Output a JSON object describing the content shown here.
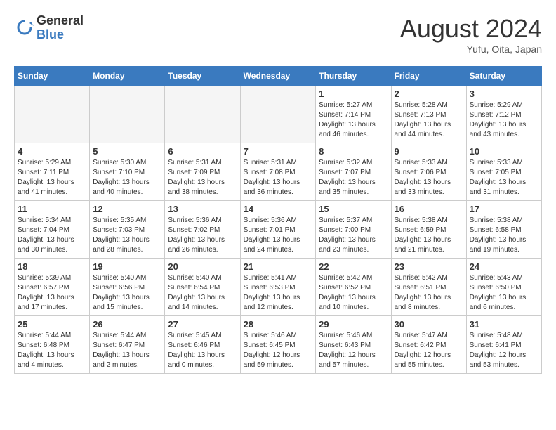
{
  "logo": {
    "general": "General",
    "blue": "Blue"
  },
  "header": {
    "month_year": "August 2024",
    "location": "Yufu, Oita, Japan"
  },
  "weekdays": [
    "Sunday",
    "Monday",
    "Tuesday",
    "Wednesday",
    "Thursday",
    "Friday",
    "Saturday"
  ],
  "weeks": [
    [
      {
        "day": "",
        "info": ""
      },
      {
        "day": "",
        "info": ""
      },
      {
        "day": "",
        "info": ""
      },
      {
        "day": "",
        "info": ""
      },
      {
        "day": "1",
        "info": "Sunrise: 5:27 AM\nSunset: 7:14 PM\nDaylight: 13 hours\nand 46 minutes."
      },
      {
        "day": "2",
        "info": "Sunrise: 5:28 AM\nSunset: 7:13 PM\nDaylight: 13 hours\nand 44 minutes."
      },
      {
        "day": "3",
        "info": "Sunrise: 5:29 AM\nSunset: 7:12 PM\nDaylight: 13 hours\nand 43 minutes."
      }
    ],
    [
      {
        "day": "4",
        "info": "Sunrise: 5:29 AM\nSunset: 7:11 PM\nDaylight: 13 hours\nand 41 minutes."
      },
      {
        "day": "5",
        "info": "Sunrise: 5:30 AM\nSunset: 7:10 PM\nDaylight: 13 hours\nand 40 minutes."
      },
      {
        "day": "6",
        "info": "Sunrise: 5:31 AM\nSunset: 7:09 PM\nDaylight: 13 hours\nand 38 minutes."
      },
      {
        "day": "7",
        "info": "Sunrise: 5:31 AM\nSunset: 7:08 PM\nDaylight: 13 hours\nand 36 minutes."
      },
      {
        "day": "8",
        "info": "Sunrise: 5:32 AM\nSunset: 7:07 PM\nDaylight: 13 hours\nand 35 minutes."
      },
      {
        "day": "9",
        "info": "Sunrise: 5:33 AM\nSunset: 7:06 PM\nDaylight: 13 hours\nand 33 minutes."
      },
      {
        "day": "10",
        "info": "Sunrise: 5:33 AM\nSunset: 7:05 PM\nDaylight: 13 hours\nand 31 minutes."
      }
    ],
    [
      {
        "day": "11",
        "info": "Sunrise: 5:34 AM\nSunset: 7:04 PM\nDaylight: 13 hours\nand 30 minutes."
      },
      {
        "day": "12",
        "info": "Sunrise: 5:35 AM\nSunset: 7:03 PM\nDaylight: 13 hours\nand 28 minutes."
      },
      {
        "day": "13",
        "info": "Sunrise: 5:36 AM\nSunset: 7:02 PM\nDaylight: 13 hours\nand 26 minutes."
      },
      {
        "day": "14",
        "info": "Sunrise: 5:36 AM\nSunset: 7:01 PM\nDaylight: 13 hours\nand 24 minutes."
      },
      {
        "day": "15",
        "info": "Sunrise: 5:37 AM\nSunset: 7:00 PM\nDaylight: 13 hours\nand 23 minutes."
      },
      {
        "day": "16",
        "info": "Sunrise: 5:38 AM\nSunset: 6:59 PM\nDaylight: 13 hours\nand 21 minutes."
      },
      {
        "day": "17",
        "info": "Sunrise: 5:38 AM\nSunset: 6:58 PM\nDaylight: 13 hours\nand 19 minutes."
      }
    ],
    [
      {
        "day": "18",
        "info": "Sunrise: 5:39 AM\nSunset: 6:57 PM\nDaylight: 13 hours\nand 17 minutes."
      },
      {
        "day": "19",
        "info": "Sunrise: 5:40 AM\nSunset: 6:56 PM\nDaylight: 13 hours\nand 15 minutes."
      },
      {
        "day": "20",
        "info": "Sunrise: 5:40 AM\nSunset: 6:54 PM\nDaylight: 13 hours\nand 14 minutes."
      },
      {
        "day": "21",
        "info": "Sunrise: 5:41 AM\nSunset: 6:53 PM\nDaylight: 13 hours\nand 12 minutes."
      },
      {
        "day": "22",
        "info": "Sunrise: 5:42 AM\nSunset: 6:52 PM\nDaylight: 13 hours\nand 10 minutes."
      },
      {
        "day": "23",
        "info": "Sunrise: 5:42 AM\nSunset: 6:51 PM\nDaylight: 13 hours\nand 8 minutes."
      },
      {
        "day": "24",
        "info": "Sunrise: 5:43 AM\nSunset: 6:50 PM\nDaylight: 13 hours\nand 6 minutes."
      }
    ],
    [
      {
        "day": "25",
        "info": "Sunrise: 5:44 AM\nSunset: 6:48 PM\nDaylight: 13 hours\nand 4 minutes."
      },
      {
        "day": "26",
        "info": "Sunrise: 5:44 AM\nSunset: 6:47 PM\nDaylight: 13 hours\nand 2 minutes."
      },
      {
        "day": "27",
        "info": "Sunrise: 5:45 AM\nSunset: 6:46 PM\nDaylight: 13 hours\nand 0 minutes."
      },
      {
        "day": "28",
        "info": "Sunrise: 5:46 AM\nSunset: 6:45 PM\nDaylight: 12 hours\nand 59 minutes."
      },
      {
        "day": "29",
        "info": "Sunrise: 5:46 AM\nSunset: 6:43 PM\nDaylight: 12 hours\nand 57 minutes."
      },
      {
        "day": "30",
        "info": "Sunrise: 5:47 AM\nSunset: 6:42 PM\nDaylight: 12 hours\nand 55 minutes."
      },
      {
        "day": "31",
        "info": "Sunrise: 5:48 AM\nSunset: 6:41 PM\nDaylight: 12 hours\nand 53 minutes."
      }
    ]
  ]
}
